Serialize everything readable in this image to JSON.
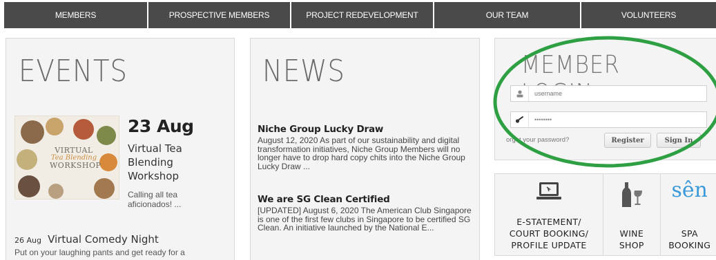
{
  "nav": {
    "items": [
      {
        "label": "MEMBERS"
      },
      {
        "label": "PROSPECTIVE MEMBERS"
      },
      {
        "label": "PROJECT REDEVELOPMENT"
      },
      {
        "label": "OUR TEAM"
      },
      {
        "label": "VOLUNTEERS"
      }
    ]
  },
  "events": {
    "title": "EVENTS",
    "featured": {
      "date": "23 Aug",
      "title": "Virtual Tea Blending Workshop",
      "description": "Calling all tea aficionados! ...",
      "poster": {
        "line1": "VIRTUAL",
        "line2": "Tea Blending",
        "line3": "WORKSHOP"
      }
    },
    "second": {
      "date": "26 Aug",
      "title": "Virtual Comedy Night",
      "description": "Put on your laughing pants and get ready for a"
    }
  },
  "news": {
    "title": "NEWS",
    "items": [
      {
        "title": "Niche Group Lucky Draw",
        "body": "August 12, 2020   As part of our sustainability and digital transformation initiatives, Niche Group Members will no longer have to drop hard copy chits into the Niche Group Lucky Draw ..."
      },
      {
        "title": "We are SG Clean Certified",
        "body": "[UPDATED] August 6, 2020    The American Club Singapore is one of the first few clubs in Singapore to be certified SG Clean. An initiative launched by the National E..."
      }
    ]
  },
  "login": {
    "title": "MEMBER LOGIN",
    "username_placeholder": "username",
    "password_value": "••••••••",
    "forgot": "orgot your password?",
    "register": "Register",
    "signin": "Sign In"
  },
  "tiles": [
    {
      "label": "E-STATEMENT/\nCOURT BOOKING/\nPROFILE UPDATE",
      "icon": "laptop-icon"
    },
    {
      "label": "WINE\nSHOP",
      "icon": "wine-bottle-icon"
    },
    {
      "label": "SPA\nBOOKING",
      "icon": "sen",
      "icon_text": "sên"
    }
  ],
  "colors": {
    "nav_bg": "#4a4a4a",
    "panel_bg": "#f4f4f4",
    "highlight_circle": "#2ea043",
    "spa_blue": "#3a9ad9"
  }
}
